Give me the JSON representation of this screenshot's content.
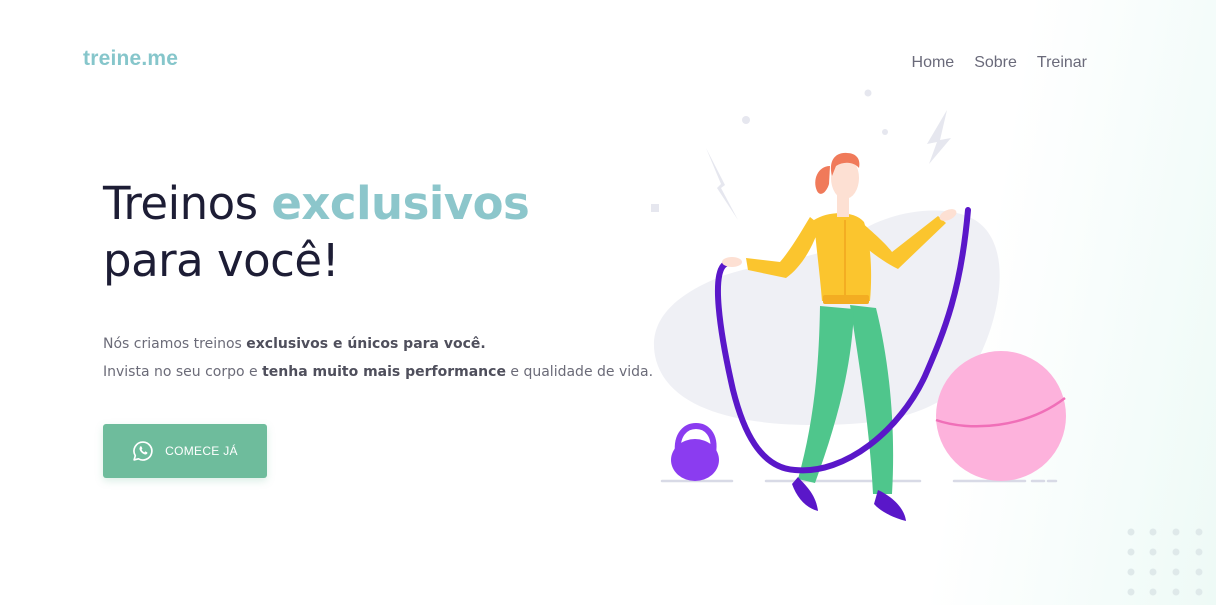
{
  "brand": {
    "logo_text": "treine.me",
    "accent_color": "#86c6cb"
  },
  "nav": {
    "items": [
      {
        "label": "Home"
      },
      {
        "label": "Sobre"
      },
      {
        "label": "Treinar"
      }
    ]
  },
  "hero": {
    "title_line1_plain": "Treinos ",
    "title_line1_accent": "exclusivos",
    "title_line2": "para você!",
    "paragraph_line1_plain": "Nós criamos treinos ",
    "paragraph_line1_bold": "exclusivos e únicos para você.",
    "paragraph_line2_plain_start": "Invista no seu corpo e ",
    "paragraph_line2_bold": "tenha muito mais performance",
    "paragraph_line2_plain_end": " e qualidade de vida."
  },
  "cta": {
    "label": "COMECE JÁ",
    "icon": "whatsapp-icon",
    "color": "#6ebc9c"
  },
  "illustration": {
    "subject": "woman-jumping-rope",
    "colors": {
      "hair": "#f07a5a",
      "jacket": "#fbc52e",
      "pants": "#4fc68c",
      "rope": "#5a17c9",
      "kettlebell": "#8b3cf0",
      "ball": "#fdb2dc",
      "blob": "#eff0f5"
    }
  }
}
